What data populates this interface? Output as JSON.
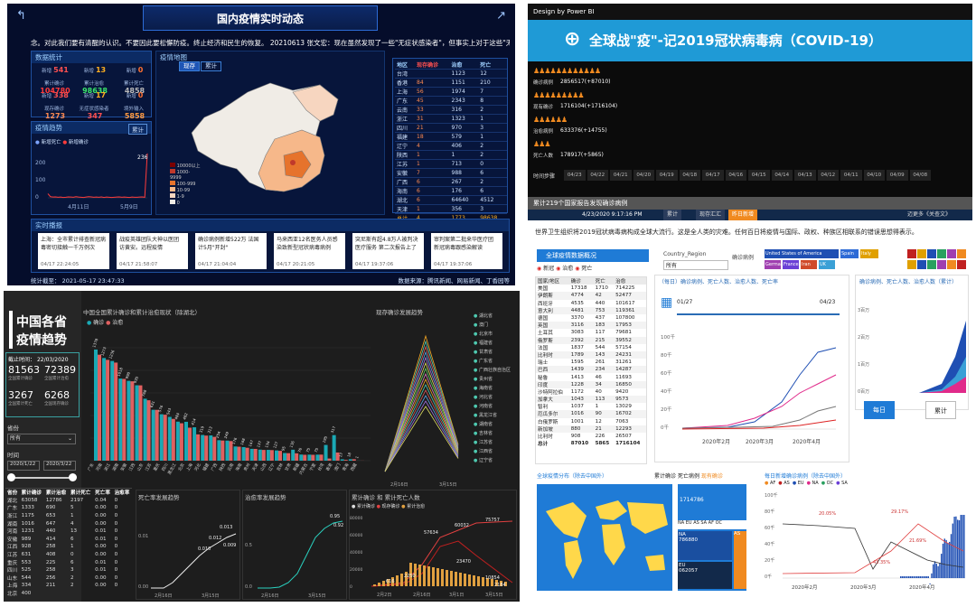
{
  "a": {
    "title": "国内疫情实时动态",
    "ticker": "念。对此我们要有清醒的认识。不要因此要松懈防疫。终止经济和民生的恢复。 20210613    张文宏：现在虽然发现了一些\"无症状感染者\"，但事实上对于这些\"无症状感",
    "stats_title": "数据统计",
    "stats": [
      {
        "t": "新增",
        "v": "541",
        "c": "#ff5050"
      },
      {
        "t": "新增",
        "v": "13",
        "c": "#ffb020"
      },
      {
        "t": "新增",
        "v": "0",
        "c": "#ff7030"
      },
      {
        "t": "累计确诊",
        "v": "104780",
        "c": "#ff3b3b"
      },
      {
        "t": "累计治愈",
        "v": "98638",
        "c": "#3be66b"
      },
      {
        "t": "累计死亡",
        "v": "4858",
        "c": "#bbbbbb"
      },
      {
        "t": "新增",
        "v": "338",
        "c": "#ff5050"
      },
      {
        "t": "新增",
        "v": "17",
        "c": "#ffb020"
      },
      {
        "t": "新增",
        "v": "0",
        "c": "#ff7030"
      },
      {
        "t": "现存确诊",
        "v": "1273",
        "c": "#ff8a50"
      },
      {
        "t": "无症状感染者",
        "v": "347",
        "c": "#ff5050"
      },
      {
        "t": "境外输入",
        "v": "5858",
        "c": "#ff9a40"
      }
    ],
    "map_title": "疫情地图",
    "map_btns": [
      "现存",
      "累计"
    ],
    "legend": [
      "10000以上",
      "1000-9999",
      "100-999",
      "10-99",
      "1-9",
      "0"
    ],
    "trend_title": "疫情趋势",
    "trend_btn": "累计",
    "trend_legend": [
      "新增死亡",
      "新增确诊"
    ],
    "trend_yticks": [
      "200",
      "100",
      "0"
    ],
    "trend_xticks": [
      "4月11日",
      "5月9日"
    ],
    "trend_values": [
      22,
      6,
      4,
      5,
      3,
      4,
      2,
      3,
      5,
      4,
      3,
      6,
      4,
      3,
      2,
      4,
      6,
      5,
      3,
      4,
      3,
      5,
      2,
      4,
      3,
      2,
      3,
      4,
      5,
      3,
      4,
      3,
      2,
      4,
      3,
      3,
      4,
      5,
      3,
      236
    ],
    "trend_peak": "236",
    "table": {
      "head": [
        "地区",
        "现存确诊",
        "治愈",
        "死亡"
      ],
      "rows": [
        [
          "台湾",
          "",
          "1123",
          "12"
        ],
        [
          "香港",
          "84",
          "1151",
          "210"
        ],
        [
          "上海",
          "56",
          "1974",
          "7"
        ],
        [
          "广东",
          "45",
          "2343",
          "8"
        ],
        [
          "云南",
          "33",
          "316",
          "2"
        ],
        [
          "浙江",
          "31",
          "1323",
          "1"
        ],
        [
          "四川",
          "21",
          "970",
          "3"
        ],
        [
          "福建",
          "18",
          "579",
          "1"
        ],
        [
          "辽宁",
          "4",
          "406",
          "2"
        ],
        [
          "陕西",
          "1",
          "1",
          "2"
        ],
        [
          "江苏",
          "1",
          "713",
          "0"
        ],
        [
          "安徽",
          "7",
          "988",
          "6"
        ],
        [
          "广西",
          "6",
          "267",
          "2"
        ],
        [
          "海南",
          "6",
          "176",
          "6"
        ],
        [
          "湖北",
          "6",
          "64640",
          "4512"
        ],
        [
          "天津",
          "1",
          "356",
          "3"
        ]
      ],
      "total": [
        "总计",
        "4",
        "1773",
        "98638"
      ]
    },
    "news_title": "实时播报",
    "news": [
      {
        "t": "上海：全市累计排查新冠病毒密切接触一千万例次",
        "d": "04/17 22:24:05"
      },
      {
        "t": "战疫英雄团队大神以医团 访黄安。远程疫情",
        "d": "04/17 21:58:07"
      },
      {
        "t": "确诊病例新增522万 法国计5月\"开封\"",
        "d": "04/17 21:04:04"
      },
      {
        "t": "马来西亚12名医务人员感染致新型冠状病毒病例",
        "d": "04/17 20:21:05"
      },
      {
        "t": "突尼斯有超4.8万人被判决 医疗服务 第二次报告上了",
        "d": "04/17 19:37:06"
      },
      {
        "t": "审判案第二批来华医疗团 新冠病毒跟感染解读",
        "d": "04/17 19:37:06"
      }
    ],
    "footer_left": "统计截至： 2021-05-17 23:47:33",
    "footer_right": "数据来源：腾讯新闻、网易新闻、丁香园等"
  },
  "b": {
    "design": "Design by Power BI",
    "banner": "全球战\"疫\"-记2019冠状病毒病（COVID-19）",
    "kpis": [
      {
        "label": "确诊病例",
        "value": "2856517(+87010)"
      },
      {
        "label": "现有确诊",
        "value": "1716104(+1716104)"
      },
      {
        "label": "治愈病例",
        "value": "633376(+14755)"
      },
      {
        "label": "死亡人数",
        "value": "178917(+5865)"
      }
    ],
    "timeline_label": "时间步骤",
    "timeline": [
      "04/23",
      "04/22",
      "04/21",
      "04/20",
      "04/19",
      "04/18",
      "04/17",
      "04/16",
      "04/15",
      "04/14",
      "04/13",
      "04/12",
      "04/11",
      "04/10",
      "04/09",
      "04/08"
    ],
    "gray_bar": "累计219个国家报告发现确诊病例",
    "navy_date": "4/23/2020 9:17:16 PM",
    "navy_btns": [
      "累计",
      "现存汇汇",
      "昨日新增"
    ],
    "navy_right": "迈更多《关查文》",
    "intro": "世界卫生组织将2019冠状病毒病构成全球大流行。这是全人类的灾难。任何百日将疫情与国际、政权、种族区相联系的错误思想得表示。",
    "overview_title": "全球疫情数据概况",
    "filters": [
      "新冠",
      "治愈",
      "死亡"
    ],
    "region_label": "Country_Region",
    "region_value": "所有",
    "confirm_label": "确诊病例",
    "swatches": [
      {
        "t": "United States of America",
        "c": "#1f4fb3"
      },
      {
        "t": "Spain",
        "c": "#2d6ad6"
      },
      {
        "t": "Italy",
        "c": "#e0a000"
      },
      {
        "t": "Germany",
        "c": "#a03fb0"
      },
      {
        "t": "France",
        "c": "#6a3fd6"
      },
      {
        "t": "Iran",
        "c": "#d04a2a"
      },
      {
        "t": "UK",
        "c": "#3aa0d6"
      }
    ],
    "table_head": [
      "国家/地区",
      "确诊",
      "死亡",
      "治愈"
    ],
    "table_rows": [
      [
        "美国",
        "17318",
        "1710",
        "714225"
      ],
      [
        "伊朗斯",
        "4774",
        "42",
        "52477"
      ],
      [
        "西班牙",
        "4535",
        "440",
        "101617"
      ],
      [
        "意大利",
        "4481",
        "753",
        "119361"
      ],
      [
        "德国",
        "3370",
        "437",
        "107800"
      ],
      [
        "英国",
        "3116",
        "183",
        "17953"
      ],
      [
        "土耳其",
        "3083",
        "117",
        "79681"
      ],
      [
        "俄罗斯",
        "2392",
        "215",
        "39552"
      ],
      [
        "法国",
        "1837",
        "544",
        "57154"
      ],
      [
        "比利时",
        "1789",
        "143",
        "24231"
      ],
      [
        "瑞士",
        "1595",
        "261",
        "31261"
      ],
      [
        "巴西",
        "1439",
        "234",
        "14287"
      ],
      [
        "秘鲁",
        "1413",
        "46",
        "11693"
      ],
      [
        "印度",
        "1228",
        "34",
        "16850"
      ],
      [
        "沙特阿拉伯",
        "1172",
        "40",
        "9420"
      ],
      [
        "加拿大",
        "1043",
        "113",
        "9573"
      ],
      [
        "智利",
        "1037",
        "1",
        "13029"
      ],
      [
        "厄瓜多尔",
        "1016",
        "90",
        "16702"
      ],
      [
        "白俄罗斯",
        "1001",
        "12",
        "7063"
      ],
      [
        "新加坡",
        "880",
        "21",
        "12293"
      ],
      [
        "比利时",
        "908",
        "226",
        "26507"
      ]
    ],
    "table_total": [
      "总计",
      "87010",
      "5865",
      "1716104"
    ],
    "line_title": "（每日）确诊病例、死亡人数、治愈人数、死亡率",
    "line_dates": [
      "01/27",
      "04/23"
    ],
    "line_yticks": [
      "100千",
      "80千",
      "60千",
      "40千",
      "20千",
      "0千"
    ],
    "line_xticks": [
      "2020年2月",
      "2020年3月",
      "2020年4月"
    ],
    "line_legend": [
      "确诊病例",
      "死亡人数",
      "治愈人数",
      "死亡率"
    ],
    "bar_title": "确诊病例、死亡人数、治愈人数（累计）",
    "bar_yticks": [
      "3百万",
      "2百万",
      "1百万",
      "0百万"
    ],
    "btn_day": "每日",
    "btn_cum": "累计",
    "map_title": "全球疫情分布（除去中国外）",
    "map_tabs": [
      "累计确诊",
      "死亡病例",
      "现有确诊"
    ],
    "tree": [
      {
        "t": "NA",
        "v": "786880"
      },
      {
        "t": "EU",
        "v": "062057"
      },
      {
        "t": "AS",
        "v": ""
      }
    ],
    "tree_top": "1714786",
    "tree_legend": [
      "NA",
      "EU",
      "AS",
      "SA",
      "AF",
      "OC"
    ],
    "daily_title": "每日新增确诊病例（除去中国外）",
    "daily_legend": [
      "AF",
      "AS",
      "EU",
      "NA",
      "OC",
      "SA"
    ],
    "daily_yticks": [
      "100千",
      "80千",
      "60千",
      "40千",
      "20千",
      "0千"
    ],
    "daily_xticks": [
      "2020年2月",
      "2020年3月",
      "2020年4月"
    ],
    "daily_pcts": [
      "20.05%",
      "29.17%",
      "21.69%",
      "43.35%"
    ]
  },
  "c": {
    "title1": "中国各省",
    "title2": "疫情趋势",
    "date_label": "截止时间：",
    "date": "22/03/2020",
    "nums": [
      {
        "v": "81563",
        "l": "全国累计确诊"
      },
      {
        "v": "72389",
        "l": "全国累计治愈"
      },
      {
        "v": "3267",
        "l": "全国累计死亡"
      },
      {
        "v": "6268",
        "l": "全国现存确诊"
      }
    ],
    "prov_label": "省份",
    "prov_value": "所有",
    "time_label": "时间",
    "date_from": "2020/1/22",
    "date_to": "2020/3/22",
    "bar_title": "中国全国累计确诊和累计治愈现状（除湖北）",
    "bar_legend": [
      "确诊",
      "治愈"
    ],
    "bar_cats": [
      "广东",
      "河南",
      "浙江",
      "湖南",
      "安徽",
      "江西",
      "山东",
      "江苏",
      "重庆",
      "四川",
      "黑龙江",
      "北京",
      "上海",
      "河北",
      "福建",
      "广西",
      "陕西",
      "云南",
      "海南",
      "贵州",
      "天津",
      "山西",
      "辽宁",
      "吉林",
      "甘肃",
      "新疆",
      "内蒙古",
      "宁夏",
      "台湾",
      "香港",
      "澳门",
      "青海",
      "西藏"
    ],
    "bar_confirm": [
      1378,
      1273,
      1236,
      1018,
      990,
      935,
      768,
      631,
      576,
      543,
      484,
      482,
      414,
      319,
      313,
      254,
      249,
      176,
      168,
      147,
      137,
      134,
      127,
      95,
      136,
      76,
      75,
      75,
      195,
      317,
      17,
      18,
      1
    ],
    "bar_cured": [
      1314,
      1250,
      1216,
      1014,
      984,
      934,
      749,
      630,
      570,
      518,
      464,
      409,
      326,
      311,
      295,
      250,
      243,
      173,
      160,
      146,
      133,
      131,
      122,
      93,
      91,
      73,
      73,
      75,
      27,
      101,
      10,
      18,
      1
    ],
    "bump_title": "现存确诊发展趋势",
    "bump_legend": [
      "湖北省",
      "澳门",
      "北京市",
      "福建省",
      "甘肃省",
      "广东省",
      "广西壮族自治区",
      "贵州省",
      "海南省",
      "河北省",
      "河南省",
      "黑龙江省",
      "湖南省",
      "吉林省",
      "江苏省",
      "江西省",
      "辽宁省"
    ],
    "bump_xticks": [
      "2月16日",
      "3月15日"
    ],
    "table_head": [
      "省份",
      "累计确诊",
      "累计治愈",
      "累计死亡",
      "死亡率",
      "治愈率"
    ],
    "table_rows": [
      [
        "湖北",
        "63058",
        "12786",
        "2197",
        "0.04",
        "0"
      ],
      [
        "广东",
        "1333",
        "690",
        "5",
        "0.00",
        "0"
      ],
      [
        "浙江",
        "1175",
        "653",
        "1",
        "0.00",
        "0"
      ],
      [
        "湖南",
        "1016",
        "647",
        "4",
        "0.00",
        "0"
      ],
      [
        "河南",
        "1231",
        "440",
        "13",
        "0.01",
        "0"
      ],
      [
        "安徽",
        "989",
        "414",
        "6",
        "0.01",
        "0"
      ],
      [
        "江西",
        "928",
        "258",
        "1",
        "0.00",
        "0"
      ],
      [
        "江苏",
        "631",
        "408",
        "0",
        "0.00",
        "0"
      ],
      [
        "重庆",
        "553",
        "225",
        "6",
        "0.01",
        "0"
      ],
      [
        "四川",
        "525",
        "258",
        "3",
        "0.01",
        "0"
      ],
      [
        "山东",
        "544",
        "256",
        "2",
        "0.00",
        "0"
      ],
      [
        "上海",
        "334",
        "211",
        "2",
        "0.00",
        "0"
      ],
      [
        "北京",
        "400",
        "",
        "",
        "",
        ""
      ]
    ],
    "death_title": "死亡率发展趋势",
    "death_vals": [
      "0.013",
      "0.012",
      "0.010",
      "0.009"
    ],
    "death_yticks": [
      "0.01",
      "0.00"
    ],
    "cure_title": "治愈率发展趋势",
    "cure_vals": [
      "0.95",
      "0.92"
    ],
    "cure_yticks": [
      "0.5",
      "0.0"
    ],
    "mix_title": "累计确诊 和 累计死亡人数",
    "mix_legend": [
      "累计确诊",
      "现存确诊",
      "累计治愈"
    ],
    "mix_yticks": [
      "80000",
      "60000",
      "40000",
      "20000",
      "0"
    ],
    "mix_vals": [
      "75757",
      "57634",
      "60032",
      "23470",
      "2250",
      "616",
      "10854",
      "2184"
    ],
    "mini_xticks": [
      "2月16日",
      "3月15日"
    ],
    "mix_xticks": [
      "2月2日",
      "2月16日",
      "3月1日",
      "3月15日"
    ]
  }
}
